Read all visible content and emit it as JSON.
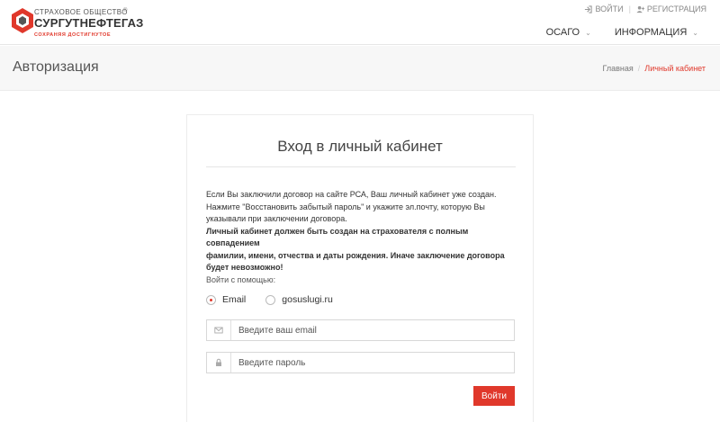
{
  "logo": {
    "top_text": "СТРАХОВОЕ ОБЩЕСТВО",
    "main_text": "СУРГУТНЕФТЕГАЗ",
    "registered": "®",
    "slogan": "СОХРАНЯЯ ДОСТИГНУТОЕ",
    "brand_color": "#e0382b"
  },
  "top_links": {
    "login_label": "ВОЙТИ",
    "login_icon": "sign-in-icon",
    "separator": "|",
    "register_label": "РЕГИСТРАЦИЯ",
    "register_icon": "user-plus-icon"
  },
  "main_nav": [
    {
      "label": "ОСАГО",
      "chevron": "⌄"
    },
    {
      "label": "ИНФОРМАЦИЯ",
      "chevron": "⌄"
    }
  ],
  "title_bar": {
    "page_title": "Авторизация",
    "breadcrumb": {
      "home": "Главная",
      "separator": "/",
      "current": "Личный кабинет"
    }
  },
  "card": {
    "title": "Вход в личный кабинет",
    "info_line1": "Если Вы заключили договор на сайте РСА, Ваш личный кабинет уже создан.",
    "info_line2": "Нажмите \"Восстановить забытый пароль\" и укажите эл.почту, которую Вы",
    "info_line3": "указывали при заключении договора.",
    "warning_line1": "Личный кабинет должен быть создан на страхователя с полным совпадением",
    "warning_line2": "фамилии, имени, отчества и даты рождения. Иначе заключение договора",
    "warning_line3": "будет невозможно!",
    "login_with_label": "Войти с помощью:",
    "options": {
      "email_label": "Email",
      "email_selected": true,
      "gosuslugi_label": "gosuslugi.ru",
      "gosuslugi_selected": false
    },
    "email_field": {
      "placeholder": "Введите ваш email",
      "value": "",
      "icon": "envelope-icon"
    },
    "password_field": {
      "placeholder": "Введите пароль",
      "value": "",
      "icon": "lock-icon"
    },
    "submit_label": "Войти"
  }
}
